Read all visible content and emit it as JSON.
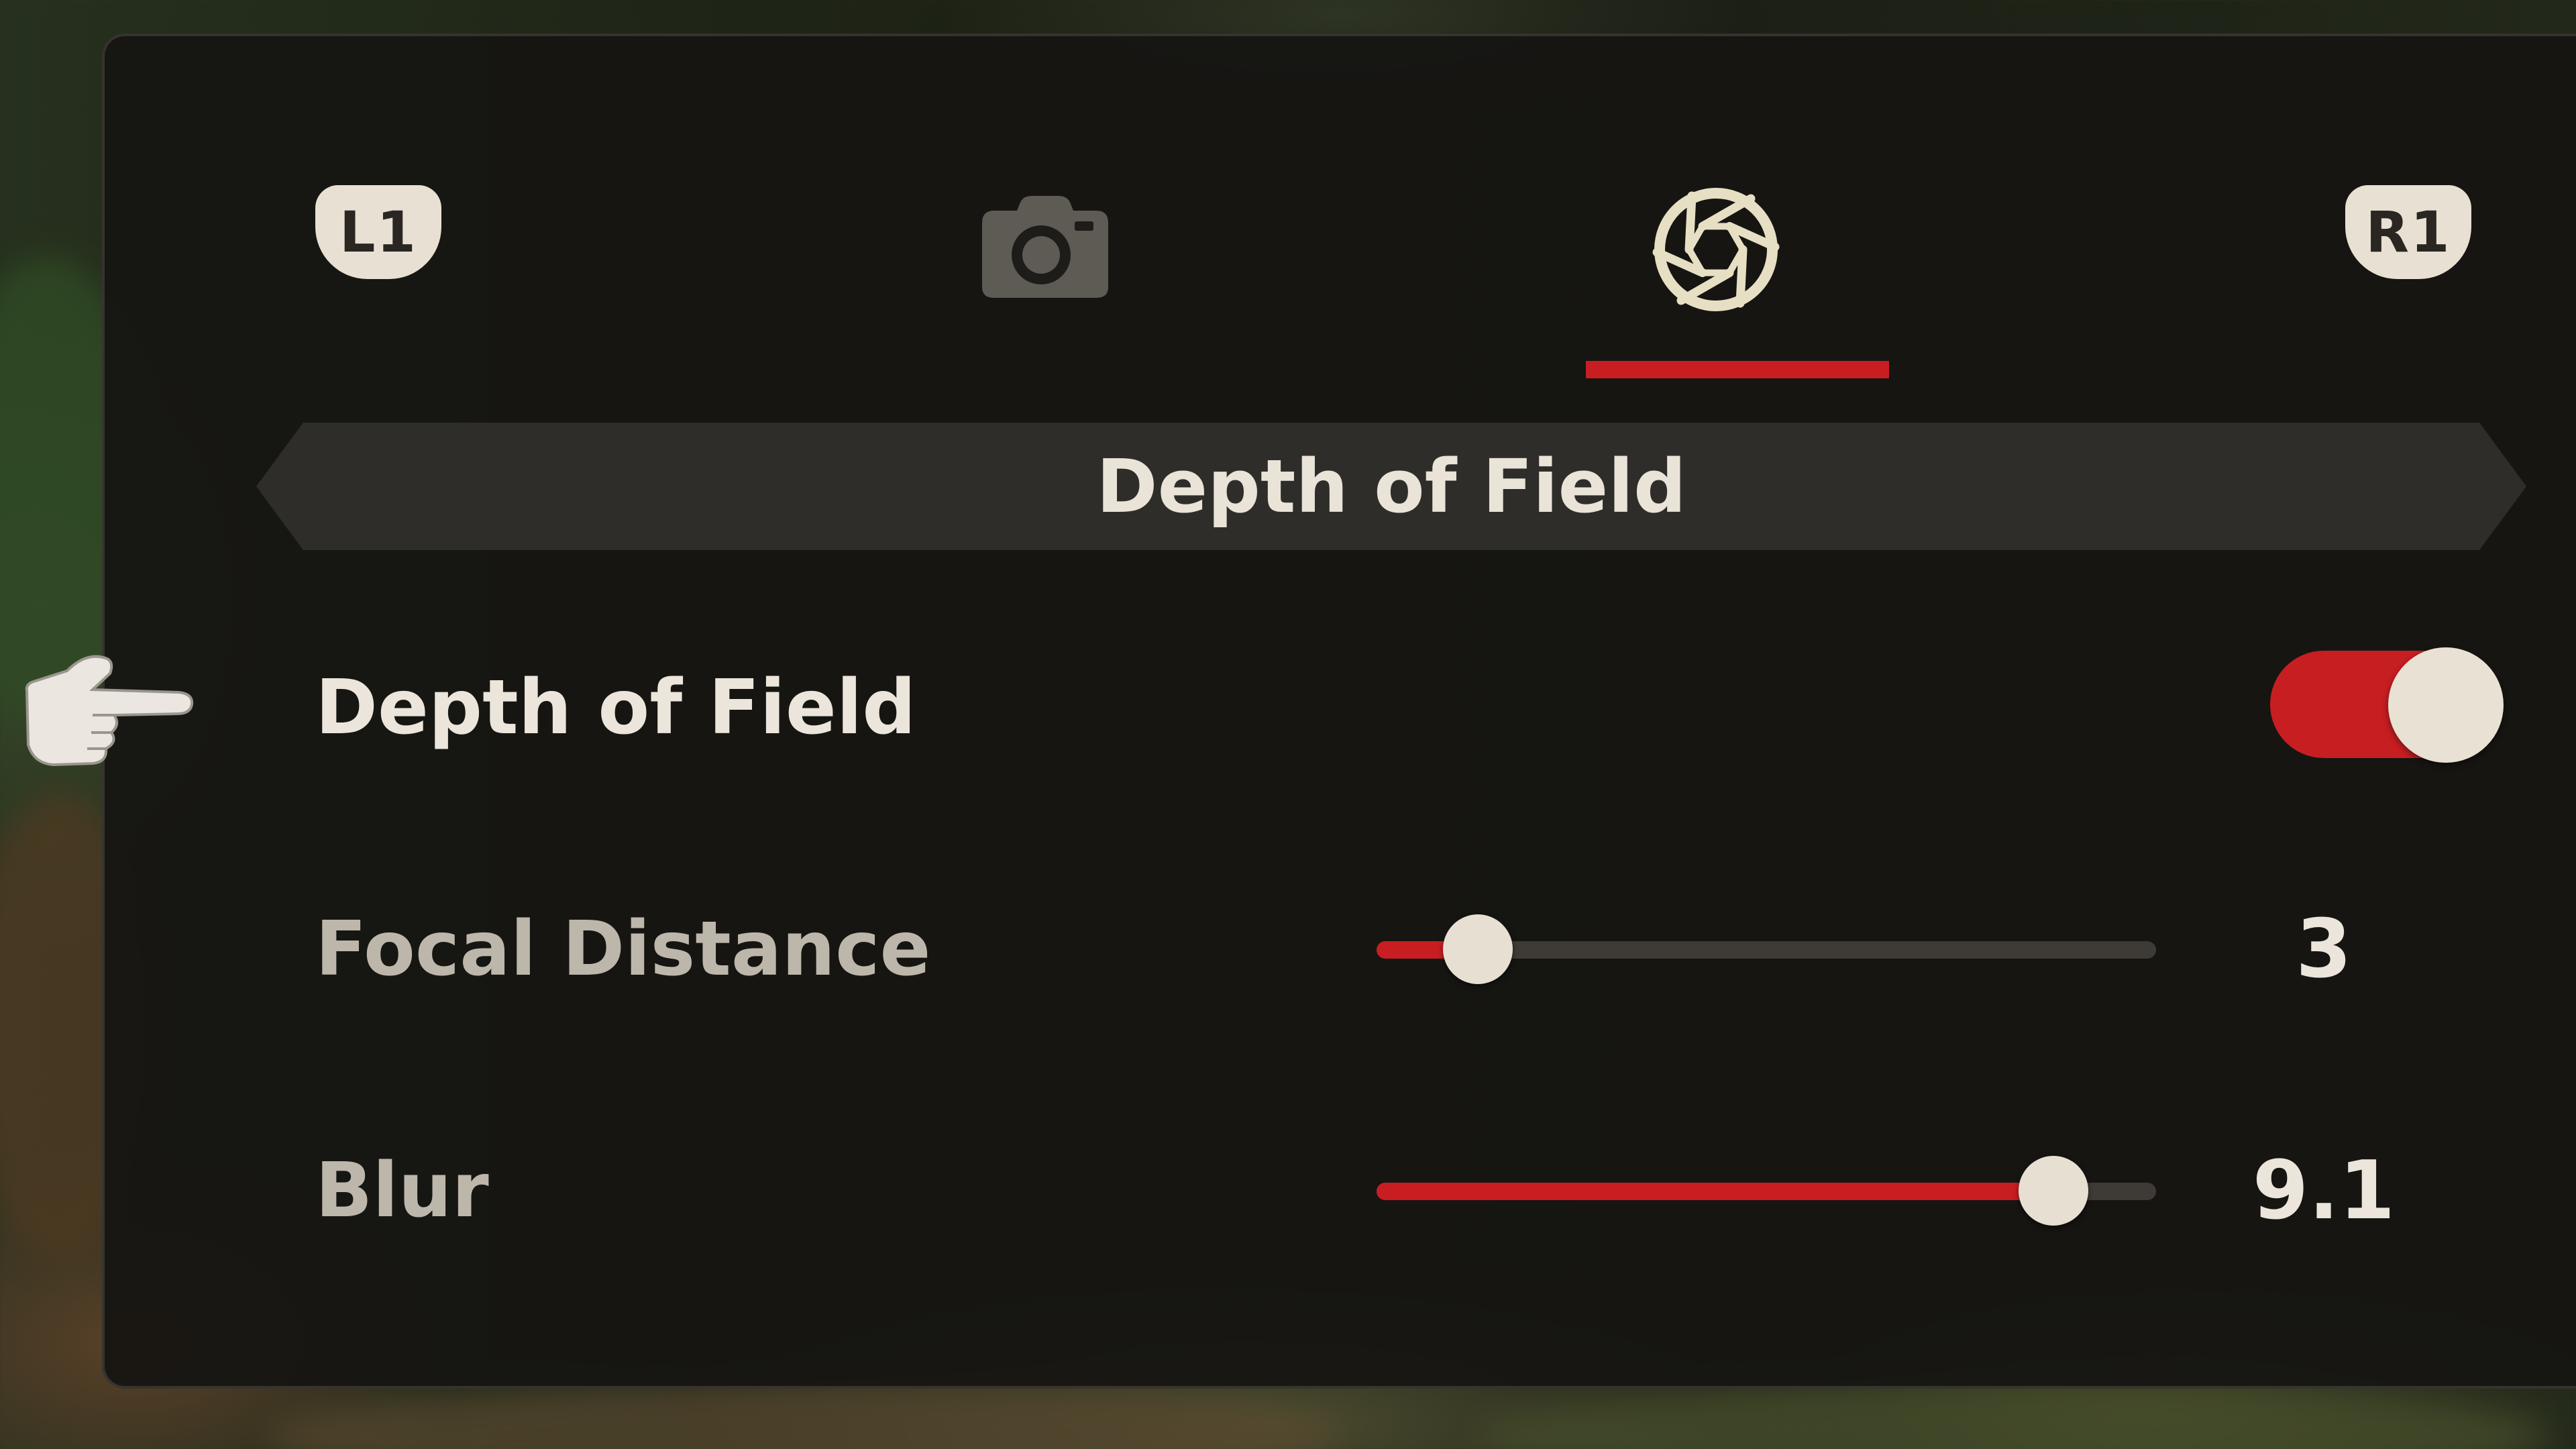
{
  "tabs": {
    "left_shoulder": "L1",
    "right_shoulder": "R1",
    "items": [
      {
        "icon": "camera-icon",
        "active": false
      },
      {
        "icon": "aperture-icon",
        "active": true
      }
    ]
  },
  "section": {
    "title": "Depth of Field"
  },
  "settings": {
    "depth_of_field": {
      "label": "Depth of Field",
      "enabled": true
    },
    "focal_distance": {
      "label": "Focal Distance",
      "value": "3",
      "fill_fraction": 0.13
    },
    "blur": {
      "label": "Blur",
      "value": "9.1",
      "fill_fraction": 0.868
    }
  },
  "colors": {
    "accent": "#c81e22",
    "text_primary": "#ebe5db",
    "text_secondary": "#bdb6ab",
    "panel_bg": "#161412",
    "knob": "#e6dfd2",
    "icon_active": "#e6dfc4",
    "icon_inactive": "#5e5a54"
  }
}
